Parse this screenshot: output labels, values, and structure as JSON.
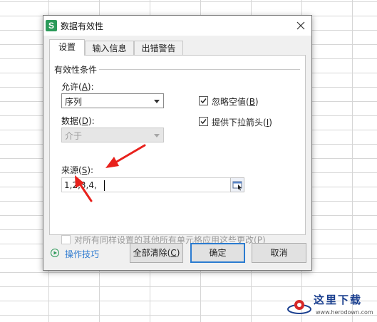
{
  "dialog": {
    "title": "数据有效性",
    "app_icon_letter": "S"
  },
  "tabs": [
    {
      "label": "设置",
      "active": true
    },
    {
      "label": "输入信息",
      "active": false
    },
    {
      "label": "出错警告",
      "active": false
    }
  ],
  "settings": {
    "group_title": "有效性条件",
    "allow_label": "允许(",
    "allow_key": "A",
    "allow_tail": "):",
    "allow_value": "序列",
    "data_label": "数据(",
    "data_key": "D",
    "data_tail": "):",
    "data_value": "介于",
    "source_label": "来源(",
    "source_key": "S",
    "source_tail": "):",
    "source_value": "1,2,3,4,",
    "ignore_blank_label": "忽略空值(",
    "ignore_blank_key": "B",
    "ignore_blank_tail": ")",
    "ignore_blank_checked": true,
    "dropdown_label": "提供下拉箭头(",
    "dropdown_key": "I",
    "dropdown_tail": ")",
    "dropdown_checked": true,
    "apply_all_label": "对所有同样设置的其他所有单元格应用这些更改(",
    "apply_all_key": "P",
    "apply_all_tail": ")",
    "apply_all_checked": false
  },
  "footer": {
    "tips_label": "操作技巧",
    "clear_label": "全部清除(",
    "clear_key": "C",
    "clear_tail": ")",
    "ok_label": "确定",
    "cancel_label": "取消"
  },
  "watermark": {
    "text": "这里下载",
    "url": "www.herodown.com"
  },
  "colors": {
    "annotation_arrow": "#e8211c",
    "tips_link": "#2f7bd0",
    "default_button_border": "#2a7bd0",
    "app_icon": "#2b9a5a"
  }
}
